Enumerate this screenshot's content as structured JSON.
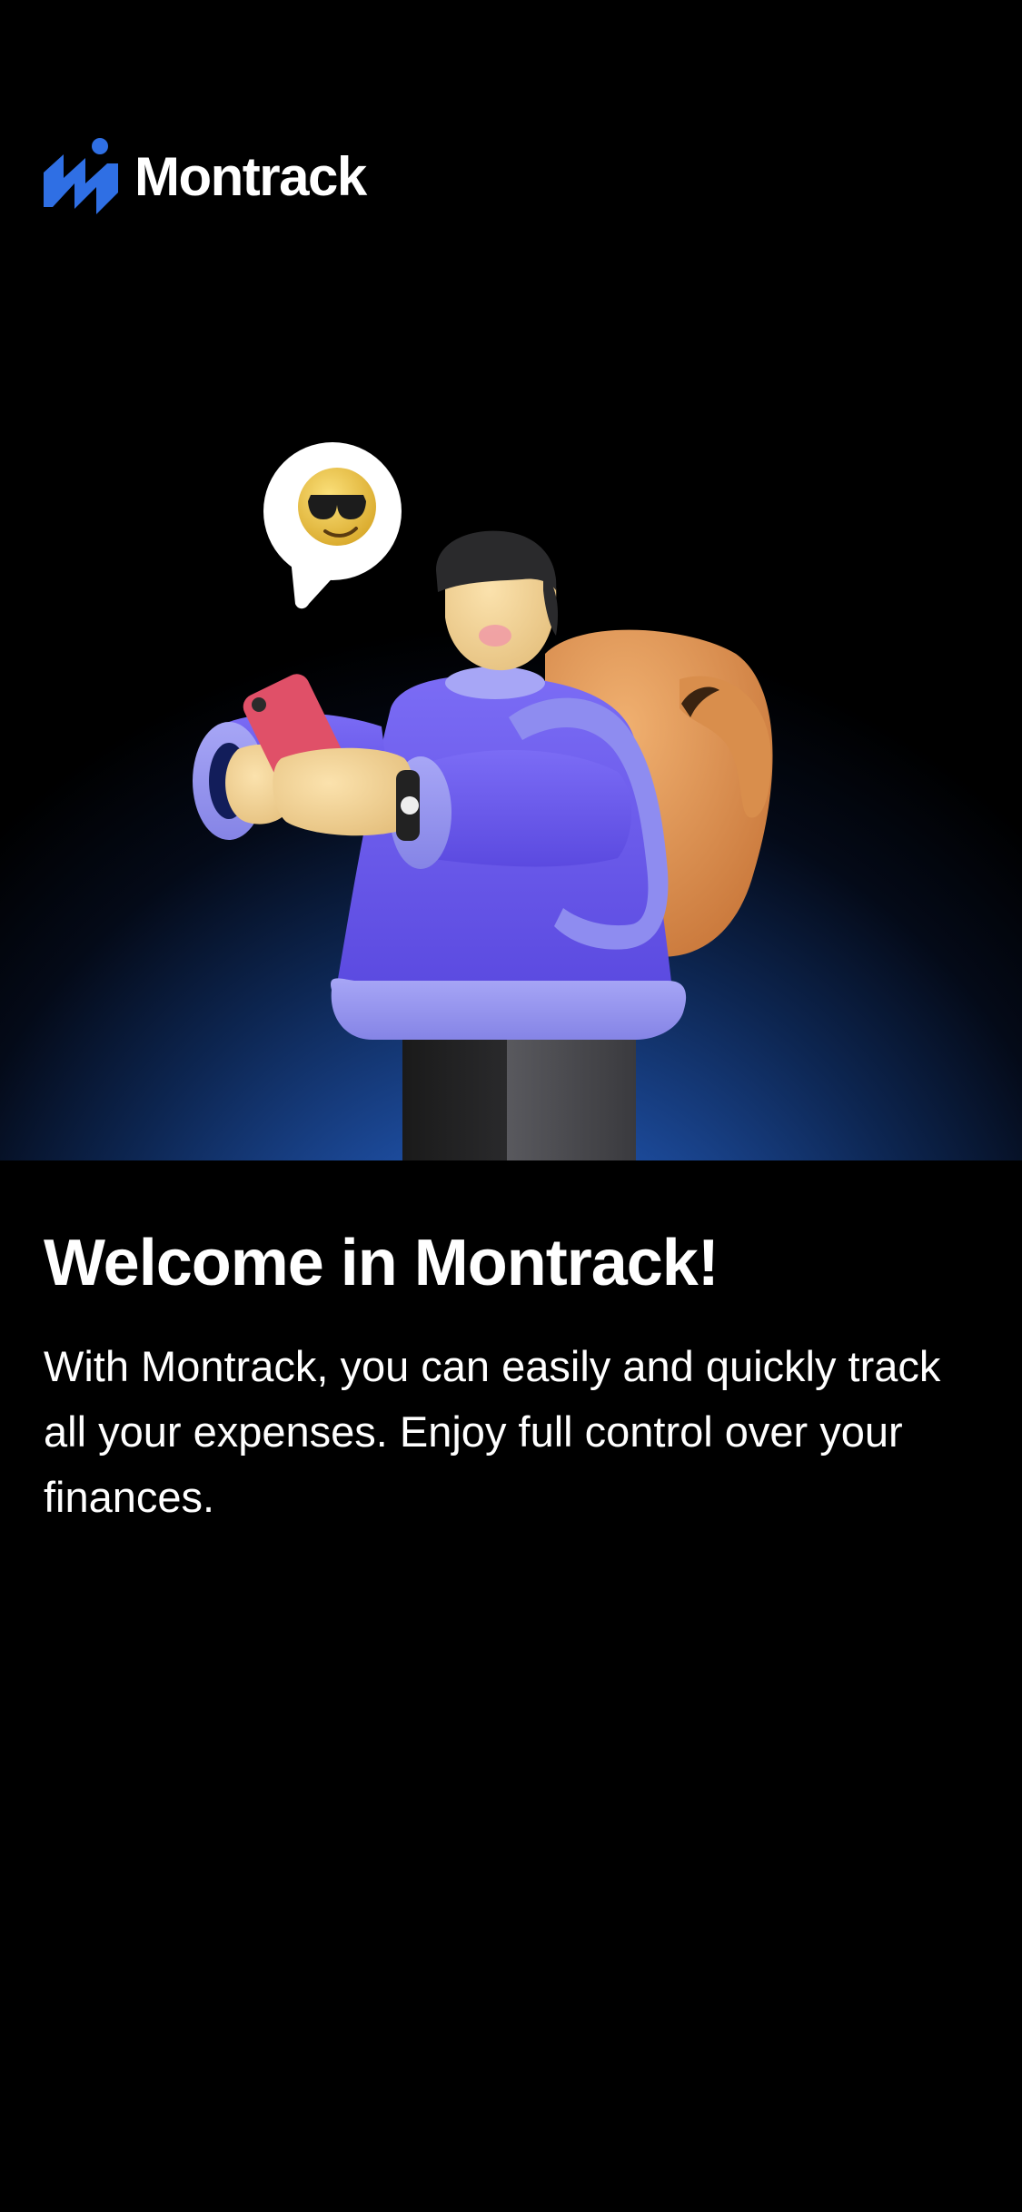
{
  "brand": {
    "name": "Montrack",
    "logo_icon": "montrack-logo-icon",
    "accent_color": "#2f6fe4"
  },
  "hero": {
    "illustration": "person-with-phone-illustration",
    "speech_bubble_icon": "sunglasses-emoji-icon",
    "background_color": "#1c4a9a"
  },
  "onboarding": {
    "title": "Welcome in Montrack!",
    "description": "With Montrack, you can easily and quickly track all your expenses. Enjoy full control over your finances."
  }
}
